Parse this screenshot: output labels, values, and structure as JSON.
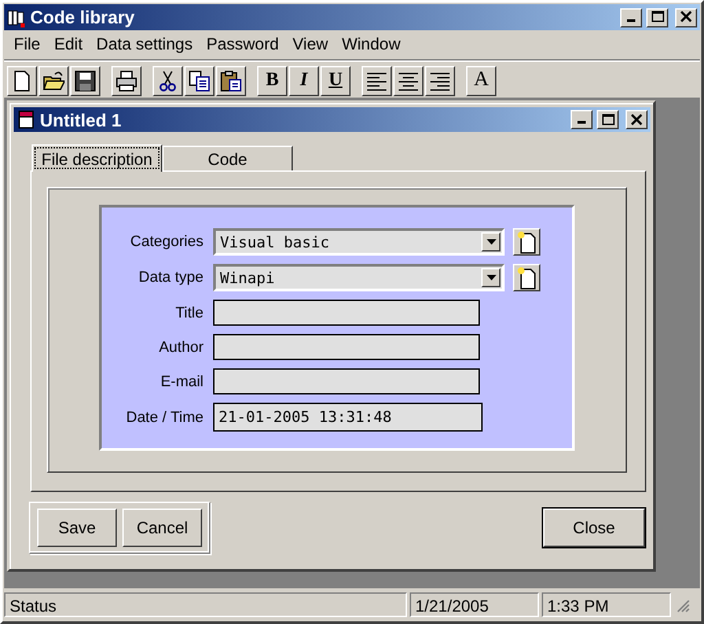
{
  "window": {
    "title": "Code library",
    "controls": [
      {
        "kind": "minimize"
      },
      {
        "kind": "maximize"
      },
      {
        "kind": "close"
      }
    ]
  },
  "menu": [
    "File",
    "Edit",
    "Data settings",
    "Password",
    "View",
    "Window"
  ],
  "toolbar": [
    [
      {
        "kind": "new"
      },
      {
        "kind": "open"
      },
      {
        "kind": "save"
      }
    ],
    [
      {
        "kind": "print"
      }
    ],
    [
      {
        "kind": "cut"
      },
      {
        "kind": "copy"
      },
      {
        "kind": "paste"
      }
    ],
    [
      {
        "kind": "bold",
        "label": "B"
      },
      {
        "kind": "italic",
        "label": "I"
      },
      {
        "kind": "underline",
        "label": "U"
      }
    ],
    [
      {
        "kind": "align-left"
      },
      {
        "kind": "align-center"
      },
      {
        "kind": "align-right"
      }
    ],
    [
      {
        "kind": "font",
        "label": "A"
      }
    ]
  ],
  "document": {
    "title": "Untitled 1",
    "controls": [
      {
        "kind": "minimize"
      },
      {
        "kind": "maximize"
      },
      {
        "kind": "close"
      }
    ],
    "tabs": [
      {
        "label": "File description",
        "selected": true
      },
      {
        "label": "Code",
        "selected": false
      }
    ],
    "form": [
      {
        "kind": "combo",
        "label": "Categories",
        "value": "Visual basic"
      },
      {
        "kind": "combo",
        "label": "Data type",
        "value": "Winapi"
      },
      {
        "kind": "text",
        "label": "Title"
      },
      {
        "kind": "text",
        "label": "Author"
      },
      {
        "kind": "text",
        "label": "E-mail"
      },
      {
        "kind": "text",
        "label": "Date / Time",
        "value": "21-01-2005 13:31:48"
      }
    ],
    "buttons": {
      "group": [
        "Save",
        "Cancel"
      ],
      "close": "Close"
    }
  },
  "status_bar": [
    "Status",
    "1/21/2005",
    "1:33 PM"
  ]
}
